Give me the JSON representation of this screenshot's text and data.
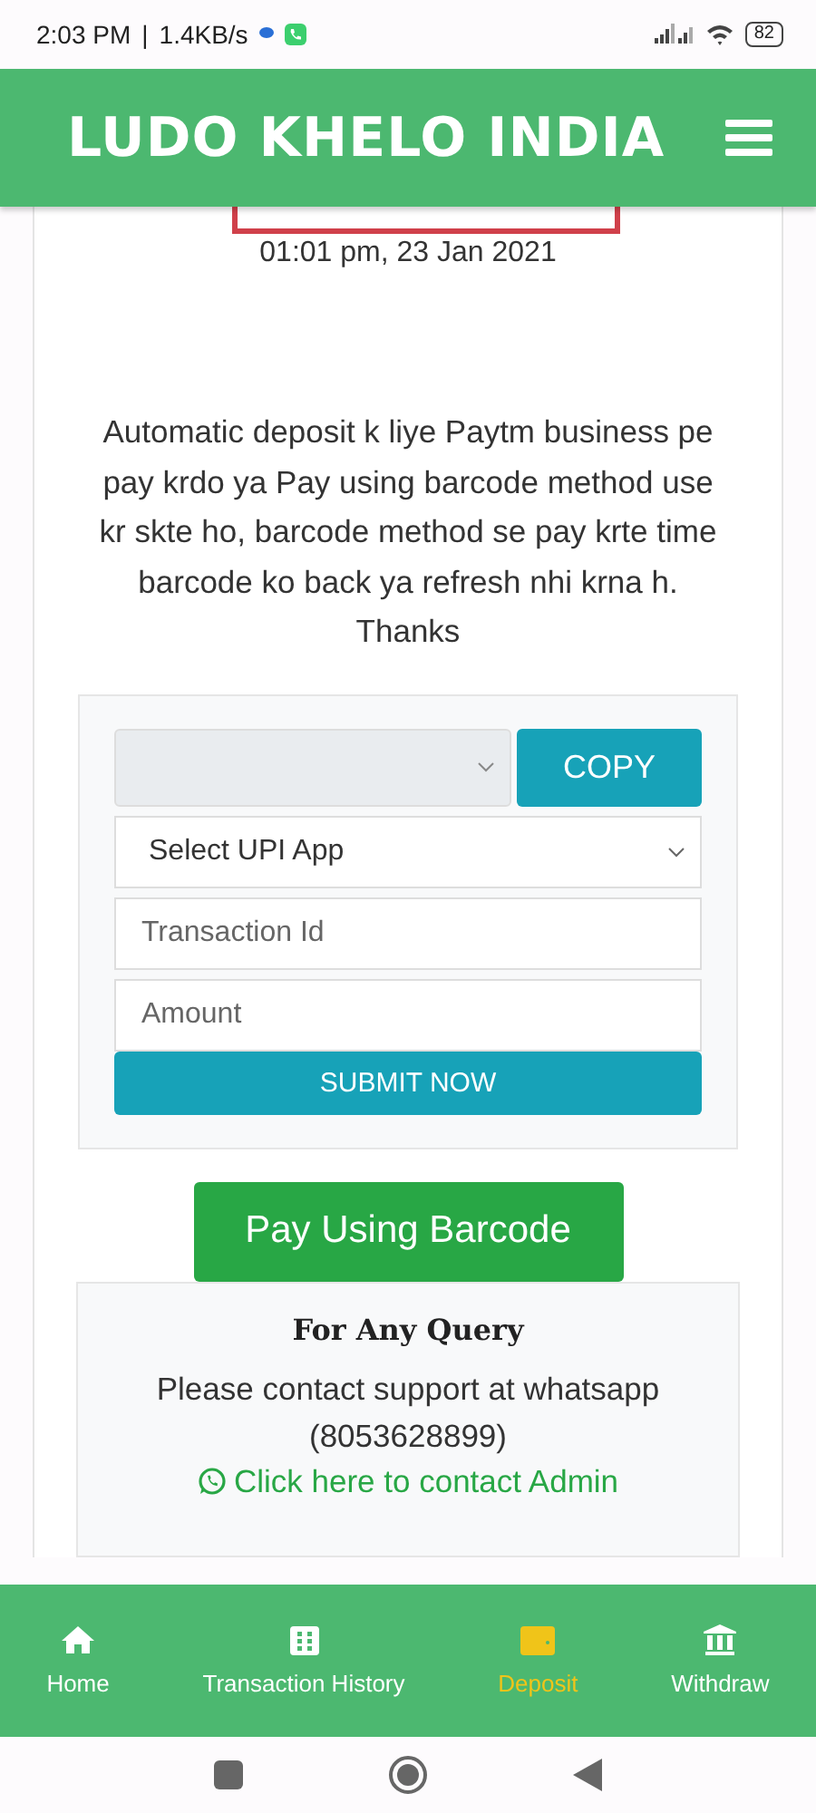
{
  "status_bar": {
    "time": "2:03 PM",
    "separator": "|",
    "speed": "1.4KB/s",
    "battery": "82"
  },
  "header": {
    "title": "LUDO KHELO INDIA"
  },
  "order": {
    "date": "01:01 pm, 23 Jan 2021"
  },
  "notice": "Automatic deposit k liye Paytm business pe pay krdo ya Pay using barcode method use kr skte ho, barcode method se pay krte time barcode ko back ya refresh nhi krna h. Thanks",
  "form": {
    "copy_button": "COPY",
    "upi_select": "Select UPI App",
    "transaction_field": {
      "placeholder": "Transaction Id"
    },
    "amount_field": {
      "placeholder": "Amount"
    },
    "submit_button": "SUBMIT NOW"
  },
  "barcode_button": "Pay Using Barcode",
  "query": {
    "title": "For Any Query",
    "text": "Please contact support at whatsapp (8053628899)",
    "link": "Click here to contact Admin"
  },
  "bottom_nav": [
    {
      "label": "Home",
      "kind": "home",
      "selected": false
    },
    {
      "label": "Transaction History",
      "kind": "history",
      "selected": false
    },
    {
      "label": "Deposit",
      "kind": "wallet",
      "selected": true
    },
    {
      "label": "Withdraw",
      "kind": "bank",
      "selected": false
    }
  ]
}
